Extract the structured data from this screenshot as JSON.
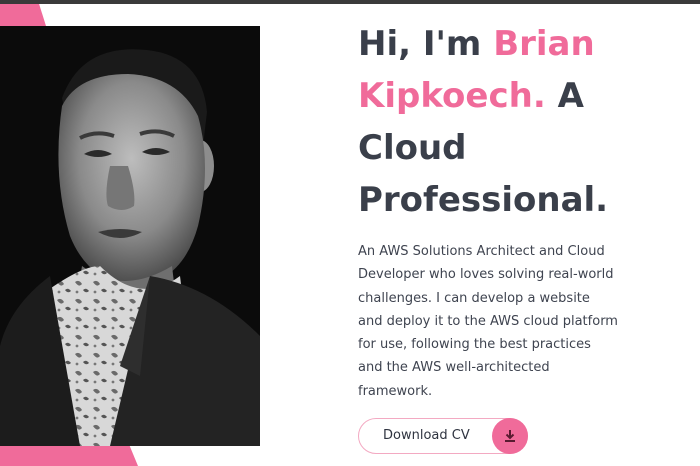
{
  "hero": {
    "greeting": "Hi, I'm ",
    "name": "Brian Kipkoech.",
    "tagline_rest": " A Cloud Professional.",
    "description": "An AWS Solutions Architect and Cloud Developer who loves solving real-world challenges. I can develop a website and deploy it to the AWS cloud platform for use, following the best practices and the AWS well-architected framework.",
    "cv_button_label": "Download CV",
    "cv_button_icon": "download-icon"
  },
  "colors": {
    "accent": "#f06b9a",
    "heading": "#3a3f4a",
    "body_text": "#3f4450"
  }
}
